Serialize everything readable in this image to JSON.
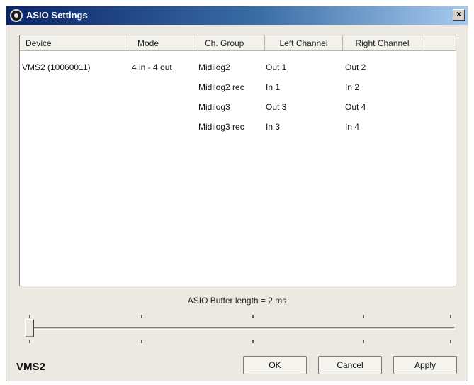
{
  "window": {
    "title": "ASIO Settings",
    "close_glyph": "×",
    "icon": "asio-app-icon"
  },
  "table": {
    "columns": [
      "Device",
      "Mode",
      "Ch. Group",
      "Left Channel",
      "Right Channel"
    ],
    "rows": [
      {
        "device": "VMS2 (10060011)",
        "mode": "4 in - 4 out",
        "group": "Midilog2",
        "left": "Out 1",
        "right": "Out 2"
      },
      {
        "device": "",
        "mode": "",
        "group": "Midilog2 rec",
        "left": "In 1",
        "right": "In 2"
      },
      {
        "device": "",
        "mode": "",
        "group": "Midilog3",
        "left": "Out 3",
        "right": "Out 4"
      },
      {
        "device": "",
        "mode": "",
        "group": "Midilog3 rec",
        "left": "In 3",
        "right": "In 4"
      }
    ]
  },
  "buffer": {
    "label": "ASIO Buffer length = 2 ms",
    "slider_position": 0
  },
  "footer": {
    "brand": "VMS2",
    "ok_label": "OK",
    "cancel_label": "Cancel",
    "apply_label": "Apply"
  }
}
